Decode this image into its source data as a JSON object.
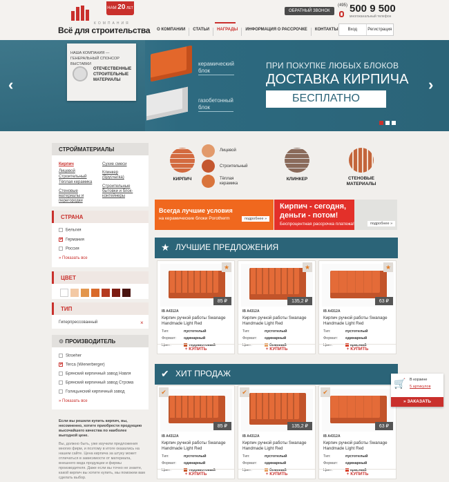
{
  "header": {
    "badge_top": "НАМ",
    "badge_num": "20",
    "badge_sub": "ЛЕТ",
    "brand_sub": "КОМПАНИЯ",
    "brand": "Всё для строительства",
    "callback": "ОБРАТНЫЙ ЗВОНОК",
    "phone_code": "(495)",
    "phone": "500 9 500",
    "phone_note": "многоканальный телефон",
    "nav": [
      "О КОМПАНИИ",
      "СТАТЬИ",
      "НАГРАДЫ",
      "ИНФОРМАЦИЯ О РАССРОЧКЕ",
      "КОНТАКТЫ"
    ],
    "login": "Вход",
    "register": "Регистрация"
  },
  "banner": {
    "sponsor_top": "НАША КОМПАНИЯ — ГЕНЕРАЛЬНЫЙ СПОНСОР ВЫСТАВКИ",
    "sponsor_text": "ОТЕЧЕСТВЕННЫЕ СТРОИТЕЛЬНЫЕ МАТЕРИАЛЫ",
    "label1a": "керамический",
    "label1b": "блок",
    "label2a": "газобетонный",
    "label2b": "блок",
    "promo1": "ПРИ ПОКУПКЕ ЛЮБЫХ БЛОКОВ",
    "promo2": "ДОСТАВКА КИРПИЧА",
    "promo3": "БЕСПЛАТНО",
    "arrow_left": "‹",
    "arrow_right": "›"
  },
  "sidebar": {
    "materials_title": "СТРОЙМАТЕРИАЛЫ",
    "col1": [
      "Кирпич",
      "Лицевой",
      "Строительный",
      "Тёплая керамика",
      "Стеновые материалы и перегородки"
    ],
    "col2": [
      "Сухие смеси",
      "Клинкер (брусчатка)",
      "Строительные бытовки и блок-контейнеры"
    ],
    "country_title": "СТРАНА",
    "countries": [
      "Бельгия",
      "Германия",
      "Россия"
    ],
    "show_all": "Показать все",
    "color_title": "ЦВЕТ",
    "colors": [
      "#ffffff",
      "#f3c9a4",
      "#e3964d",
      "#d96a2a",
      "#b53a1f",
      "#7d1c12",
      "#4a1410"
    ],
    "type_title": "ТИП",
    "type_value": "Гиперпрессованный",
    "type_close": "×",
    "maker_title": "ПРОИЗВОДИТЕЛЬ",
    "makers": [
      "Stroeher",
      "Terca (Wienerberger)",
      "Брянский кирпичный завод Навля",
      "Брянский кирпичный завод Строма",
      "Голицынский кирпичный завод"
    ],
    "makers_show_all": "Показать все",
    "seo_bold": "Если вы решили купить кирпич, вы, несомненно, хотите приобрести продукцию высочайшего качества по наиболее выгодной цене.",
    "seo_text": "Вы, должно быть, уже изучили предложения многих фирм, и поэтому в итоге оказались на нашем сайте. Цена кирпича за штуку может отличаться в зависимости от материала, внешнего вида продукции и фирмы производителя. Даже если вы точно не знаете, какой кирпич вы хотите купить, мы поможем вам сделать выбор."
  },
  "categories": {
    "brick": "КИРПИЧ",
    "face": "Лицевой",
    "build": "Строительный",
    "warm": "Тёплая керамика",
    "clinker": "КЛИНКЕР",
    "walls": "СТЕНОВЫЕ МАТЕРИАЛЫ"
  },
  "ads": {
    "ad1_line1": "Всегда лучшие условия",
    "ad1_line2": "на керамические блоки Porotherm",
    "ad1_more": "подробнее »",
    "ad2_line1": "Кирпич - сегодня,",
    "ad2_line2": "деньги - потом!",
    "ad2_line3": "Беспроцентная рассрочка платежа!",
    "ad2_more": "подробнее »"
  },
  "best": {
    "title": "ЛУЧШИЕ ПРЕДЛОЖЕНИЯ",
    "icon": "★",
    "products": [
      {
        "price": "85 ₽",
        "code": "IB A4312A",
        "name": "Кирпич ручной работы Swanage Handmade Light Red",
        "type_label": "Тип:",
        "type": "пустотелый",
        "format_label": "Формат:",
        "format": "одинарный",
        "color_label": "Цвет:",
        "color": "терракотовый",
        "dot": "#c9582a",
        "buy": "+ КУПИТЬ"
      },
      {
        "price": "135,2 ₽",
        "code": "IB A4312A",
        "name": "Кирпич ручной работы Swanage Handmade Light Red",
        "type_label": "Тип:",
        "type": "пустотелый",
        "format_label": "Формат:",
        "format": "одинарный",
        "color_label": "Цвет:",
        "color": "бежевый",
        "dot": "#e8a263",
        "buy": "+ КУПИТЬ"
      },
      {
        "price": "63 ₽",
        "code": "IB A4312A",
        "name": "Кирпич ручной работы Swanage Handmade Light Red",
        "type_label": "Тип:",
        "type": "пустотелый",
        "format_label": "Формат:",
        "format": "одинарный",
        "color_label": "Цвет:",
        "color": "красный",
        "dot": "#d9412a",
        "buy": "+ КУПИТЬ"
      }
    ]
  },
  "hits": {
    "title": "ХИТ ПРОДАЖ",
    "icon": "✔",
    "products": [
      {
        "price": "85 ₽",
        "code": "IB A4312A",
        "name": "Кирпич ручной работы Swanage Handmade Light Red",
        "type_label": "Тип:",
        "type": "пустотелый",
        "format_label": "Формат:",
        "format": "одинарный",
        "color_label": "Цвет:",
        "color": "терракотовый",
        "dot": "#c9582a",
        "buy": "+ КУПИТЬ"
      },
      {
        "price": "135,2 ₽",
        "code": "IB A4312A",
        "name": "Кирпич ручной работы Swanage Handmade Light Red",
        "type_label": "Тип:",
        "type": "пустотелый",
        "format_label": "Формат:",
        "format": "одинарный",
        "color_label": "Цвет:",
        "color": "бежевый",
        "dot": "#e8a263",
        "buy": "+ КУПИТЬ"
      },
      {
        "price": "63 ₽",
        "code": "IB A4312A",
        "name": "Кирпич ручной работы Swanage Handmade Light Red",
        "type_label": "Тип:",
        "type": "пустотелый",
        "format_label": "Формат:",
        "format": "одинарный",
        "color_label": "Цвет:",
        "color": "красный",
        "dot": "#d9412a",
        "buy": "+ КУПИТЬ"
      }
    ]
  },
  "cart": {
    "label": "В корзине",
    "count": "5 артикулов",
    "order": "» ЗАКАЗАТЬ"
  }
}
